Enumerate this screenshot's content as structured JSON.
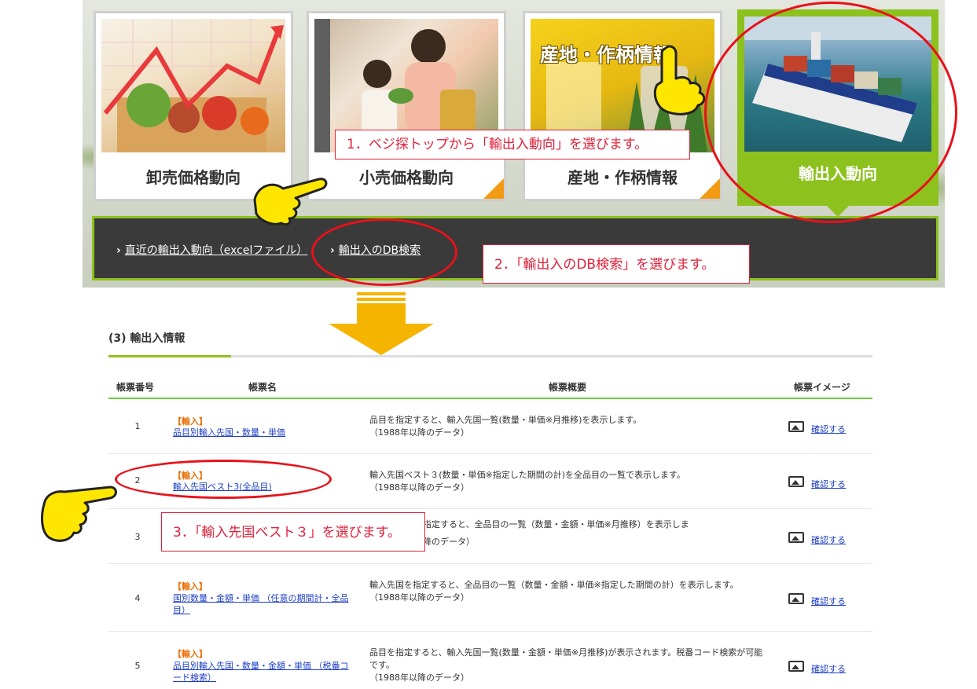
{
  "banner": {
    "cards": [
      {
        "label": "卸売価格動向",
        "photo": "vegetables-price-chart"
      },
      {
        "label": "小売価格動向",
        "photo": "shopping-family"
      },
      {
        "label": "産地・作柄情報",
        "photo": "field-info",
        "photo_title": "産地・作柄情報"
      },
      {
        "label": "輸出入動向",
        "photo": "container-ship",
        "active": true
      }
    ],
    "submenu": [
      {
        "label": "直近の輸出入動向（excelファイル）"
      },
      {
        "label": "輸出入のDB検索"
      }
    ]
  },
  "notes": {
    "n1": "1．ベジ探トップから「輸出入動向」を選びます。",
    "n2": "2．「輸出入のDB検索」を選びます。",
    "n3": "3．「輸入先国ベスト３」を選びます。"
  },
  "section": {
    "title": "(3) 輸出入情報",
    "headers": {
      "no": "帳票番号",
      "name": "帳票名",
      "summary": "帳票概要",
      "image": "帳票イメージ"
    },
    "rows": [
      {
        "no": "1",
        "kind": "【輸入】",
        "name": "品目別輸入先国・数量・単価",
        "desc": "品目を指定すると、輸入先国一覧(数量・単価※月推移)を表示します。\n（1988年以降のデータ）",
        "link": "確認する"
      },
      {
        "no": "2",
        "kind": "【輸入】",
        "name": "輸入先国ベスト3(全品目)",
        "desc": "輸入先国ベスト３(数量・単価※指定した期間の計)を全品目の一覧で表示します。\n（1988年以降のデータ）",
        "link": "確認する"
      },
      {
        "no": "3",
        "kind": "",
        "name": "",
        "desc": "指定すると、全品目の一覧（数量・金額・単価※月推移）を表示しま\n降のデータ）",
        "link": "確認する"
      },
      {
        "no": "4",
        "kind": "【輸入】",
        "name": "国別数量・金額・単価 （任意の期間計・全品目）",
        "desc": "輸入先国を指定すると、全品目の一覧（数量・金額・単価※指定した期間の計）を表示します。\n（1988年以降のデータ）",
        "link": "確認する"
      },
      {
        "no": "5",
        "kind": "【輸入】",
        "name": "品目別輸入先国・数量・金額・単価 （税番コード検索）",
        "desc": "品目を指定すると、輸入先国一覧(数量・金額・単価※月推移)が表示されます。税番コード検索が可能です。\n（1988年以降のデータ）",
        "link": "確認する"
      }
    ]
  },
  "colors": {
    "accent": "#8dc11e",
    "annotation": "#e8111a",
    "link": "#1d3ec7",
    "import_tag": "#e8730c",
    "arrow": "#f5b400"
  }
}
